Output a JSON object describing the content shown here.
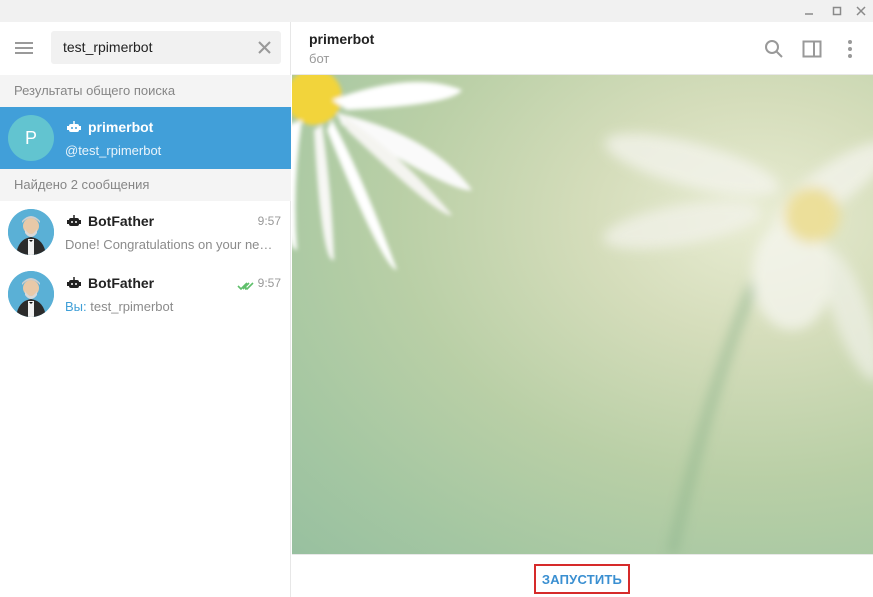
{
  "window": {
    "controls": [
      "minimize-icon",
      "maximize-icon",
      "close-icon"
    ]
  },
  "sidebar": {
    "search": {
      "value": "test_rpimerbot"
    },
    "global_results_header": "Результаты общего поиска",
    "global_result": {
      "avatar_letter": "P",
      "name": "primerbot",
      "username": "@test_rpimerbot"
    },
    "messages_header": "Найдено 2 сообщения",
    "messages": [
      {
        "name": "BotFather",
        "time": "9:57",
        "text": "Done! Congratulations on your new bot. You will find it at",
        "prefix": "",
        "read": false
      },
      {
        "name": "BotFather",
        "time": "9:57",
        "text": "test_rpimerbot",
        "prefix": "Вы:",
        "read": true
      }
    ]
  },
  "chat": {
    "title": "primerbot",
    "status": "бот",
    "start_label": "ЗАПУСТИТЬ"
  },
  "colors": {
    "accent": "#419fd9",
    "highlight_border": "#d62a2a",
    "start_text": "#3a8fd1"
  }
}
